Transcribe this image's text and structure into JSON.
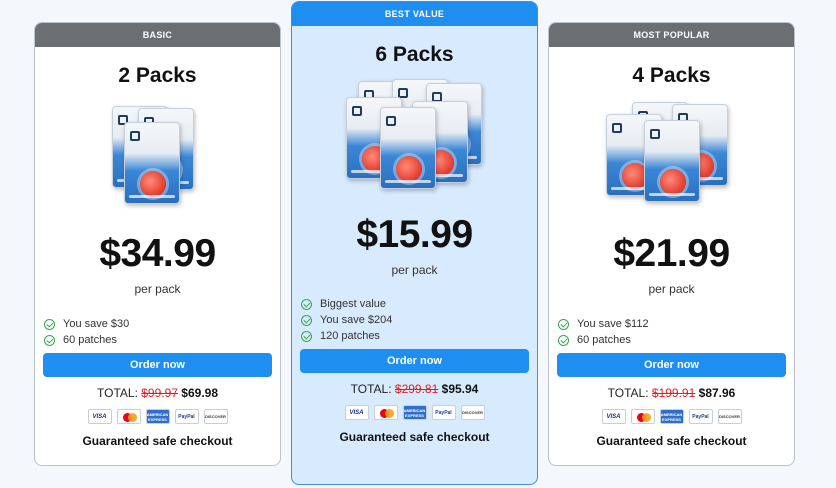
{
  "cards": [
    {
      "banner": "BASIC",
      "title": "2 Packs",
      "price": "$34.99",
      "per": "per pack",
      "features": [
        "You save $30",
        "60 patches"
      ],
      "order_label": "Order now",
      "total_label": "TOTAL:",
      "old_price": "$99.97",
      "new_price": "$69.98",
      "safe": "Guaranteed safe checkout"
    },
    {
      "banner": "BEST VALUE",
      "title": "6 Packs",
      "price": "$15.99",
      "per": "per pack",
      "features": [
        "Biggest value",
        "You save $204",
        "120 patches"
      ],
      "order_label": "Order now",
      "total_label": "TOTAL:",
      "old_price": "$299.81",
      "new_price": "$95.94",
      "safe": "Guaranteed safe checkout"
    },
    {
      "banner": "MOST POPULAR",
      "title": "4 Packs",
      "price": "$21.99",
      "per": "per pack",
      "features": [
        "You save $112",
        "60 patches"
      ],
      "order_label": "Order now",
      "total_label": "TOTAL:",
      "old_price": "$199.91",
      "new_price": "$87.96",
      "safe": "Guaranteed safe checkout"
    }
  ],
  "payment_methods": {
    "visa": "VISA",
    "amex": "AMERICAN EXPRESS",
    "paypal": "PayPal",
    "discover": "DISCOVER"
  },
  "colors": {
    "accent": "#1e8ff0",
    "banner_gray": "#6b6f72",
    "highlight_bg": "#d8eafd",
    "strike_red": "#e02020",
    "check_green": "#3aa54a"
  }
}
